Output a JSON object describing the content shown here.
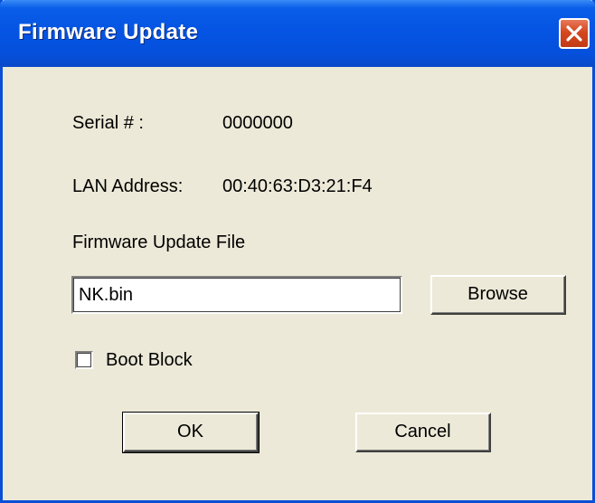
{
  "window": {
    "title": "Firmware Update",
    "close_icon": "close-icon"
  },
  "info": {
    "serial_label": "Serial # :",
    "serial_value": "0000000",
    "lan_label": "LAN Address:",
    "lan_value": "00:40:63:D3:21:F4"
  },
  "file": {
    "label": "Firmware Update File",
    "value": "NK.bin",
    "browse_label": "Browse"
  },
  "options": {
    "boot_block_label": "Boot Block",
    "boot_block_checked": false
  },
  "actions": {
    "ok_label": "OK",
    "cancel_label": "Cancel"
  },
  "colors": {
    "titlebar": "#0554e3",
    "dialog_bg": "#ece9d8",
    "close_button": "#d4481f"
  }
}
